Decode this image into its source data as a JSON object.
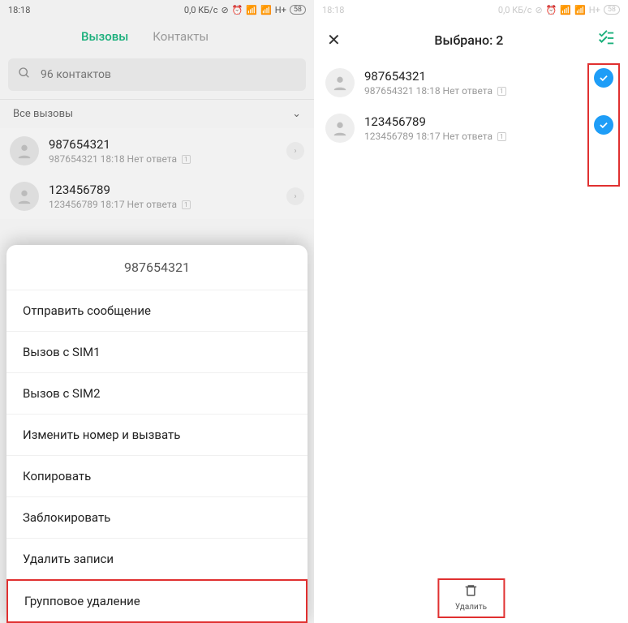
{
  "status": {
    "time": "18:18",
    "net": "0,0 КБ/с",
    "sig": "H+",
    "bat": "58"
  },
  "left": {
    "tabs": {
      "calls": "Вызовы",
      "contacts": "Контакты"
    },
    "search_placeholder": "96 контактов",
    "filter": "Все вызовы",
    "rows": [
      {
        "num": "987654321",
        "meta": "987654321  18:18 Нет ответа"
      },
      {
        "num": "123456789",
        "meta": "123456789  18:17 Нет ответа"
      }
    ],
    "sheet": {
      "title": "987654321",
      "items": [
        "Отправить сообщение",
        "Вызов с SIM1",
        "Вызов с SIM2",
        "Изменить номер и вызвать",
        "Копировать",
        "Заблокировать",
        "Удалить записи",
        "Групповое удаление"
      ]
    }
  },
  "right": {
    "title": "Выбрано: 2",
    "rows": [
      {
        "num": "987654321",
        "meta": "987654321  18:18 Нет ответа"
      },
      {
        "num": "123456789",
        "meta": "123456789  18:17 Нет ответа"
      }
    ],
    "delete": "Удалить"
  }
}
